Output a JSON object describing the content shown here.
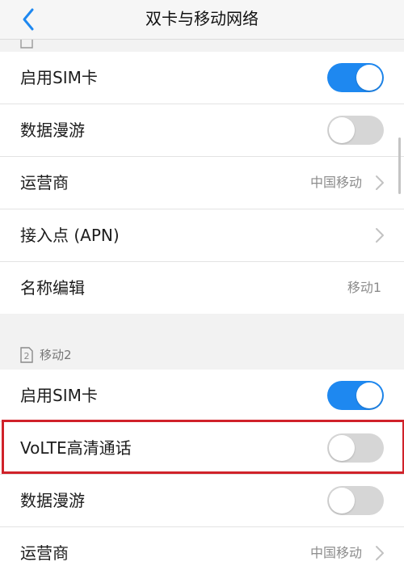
{
  "nav": {
    "title": "双卡与移动网络",
    "back_icon": "chevron-left-icon"
  },
  "sim1": {
    "rows": [
      {
        "label": "启用SIM卡",
        "toggle": "on"
      },
      {
        "label": "数据漫游",
        "toggle": "off"
      },
      {
        "label": "运营商",
        "value": "中国移动",
        "chevron": true
      },
      {
        "label": "接入点 (APN)",
        "chevron": true
      },
      {
        "label": "名称编辑",
        "value": "移动1"
      }
    ]
  },
  "sim2": {
    "section_icon": "sim-card-2-icon",
    "section_label": "移动2",
    "rows": [
      {
        "label": "启用SIM卡",
        "toggle": "on"
      },
      {
        "label": "VoLTE高清通话",
        "toggle": "off",
        "highlighted": true
      },
      {
        "label": "数据漫游",
        "toggle": "off"
      },
      {
        "label": "运营商",
        "value": "中国移动",
        "chevron": true
      }
    ]
  },
  "colors": {
    "toggle_on": "#1e88f0",
    "toggle_off": "#d6d6d6",
    "highlight": "#d0222a"
  }
}
